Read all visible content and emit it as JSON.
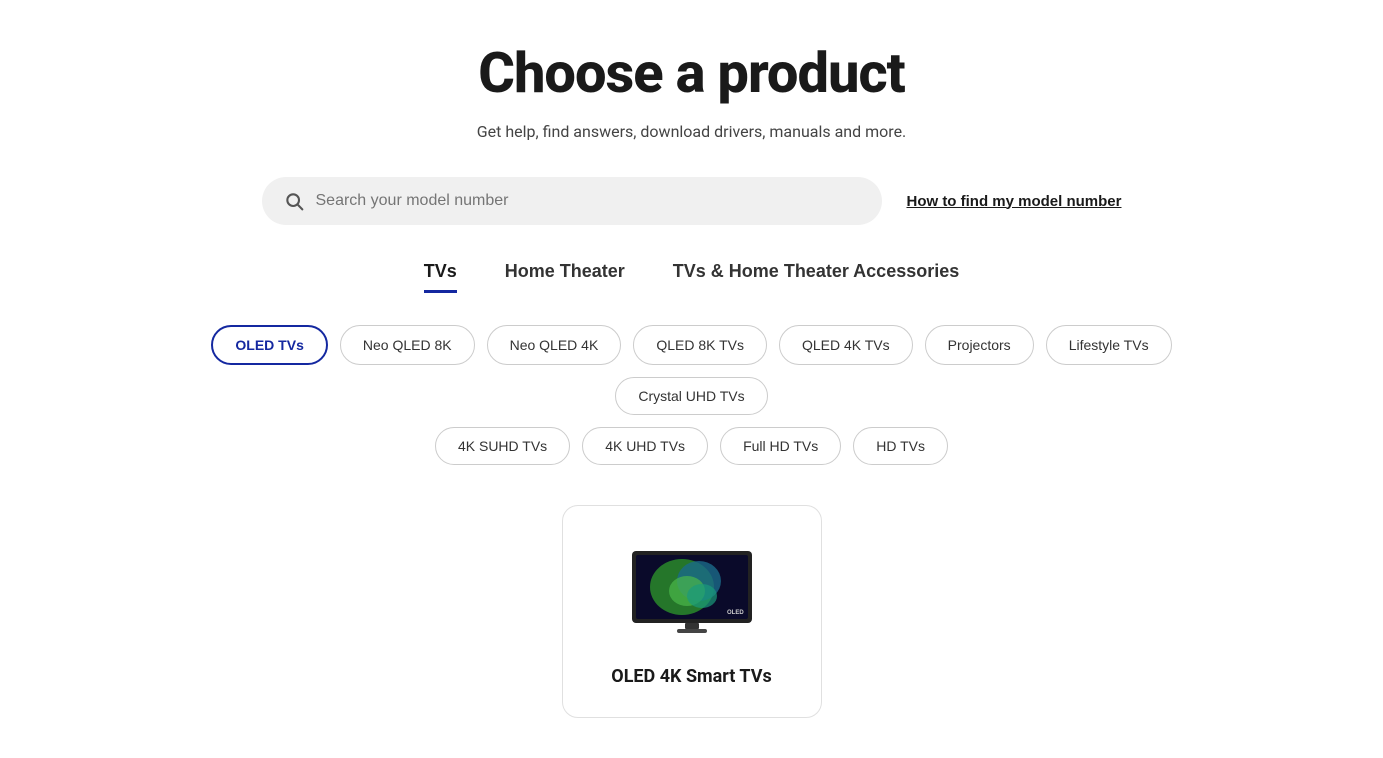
{
  "page": {
    "title": "Choose a product",
    "subtitle": "Get help, find answers, download drivers, manuals and more."
  },
  "search": {
    "placeholder": "Search your model number",
    "model_number_link": "How to find my model number"
  },
  "tabs": [
    {
      "id": "tvs",
      "label": "TVs",
      "active": true
    },
    {
      "id": "home-theater",
      "label": "Home Theater",
      "active": false
    },
    {
      "id": "accessories",
      "label": "TVs & Home Theater Accessories",
      "active": false
    }
  ],
  "filters_row1": [
    {
      "id": "oled-tvs",
      "label": "OLED TVs",
      "selected": true
    },
    {
      "id": "neo-qled-8k",
      "label": "Neo QLED 8K",
      "selected": false
    },
    {
      "id": "neo-qled-4k",
      "label": "Neo QLED 4K",
      "selected": false
    },
    {
      "id": "qled-8k-tvs",
      "label": "QLED 8K TVs",
      "selected": false
    },
    {
      "id": "qled-4k-tvs",
      "label": "QLED 4K TVs",
      "selected": false
    },
    {
      "id": "projectors",
      "label": "Projectors",
      "selected": false
    },
    {
      "id": "lifestyle-tvs",
      "label": "Lifestyle TVs",
      "selected": false
    },
    {
      "id": "crystal-uhd-tvs",
      "label": "Crystal UHD TVs",
      "selected": false
    }
  ],
  "filters_row2": [
    {
      "id": "4k-suhd-tvs",
      "label": "4K SUHD TVs",
      "selected": false
    },
    {
      "id": "4k-uhd-tvs",
      "label": "4K UHD TVs",
      "selected": false
    },
    {
      "id": "full-hd-tvs",
      "label": "Full HD TVs",
      "selected": false
    },
    {
      "id": "hd-tvs",
      "label": "HD TVs",
      "selected": false
    }
  ],
  "product_card": {
    "title": "OLED 4K Smart TVs"
  },
  "colors": {
    "accent": "#1428a0"
  }
}
